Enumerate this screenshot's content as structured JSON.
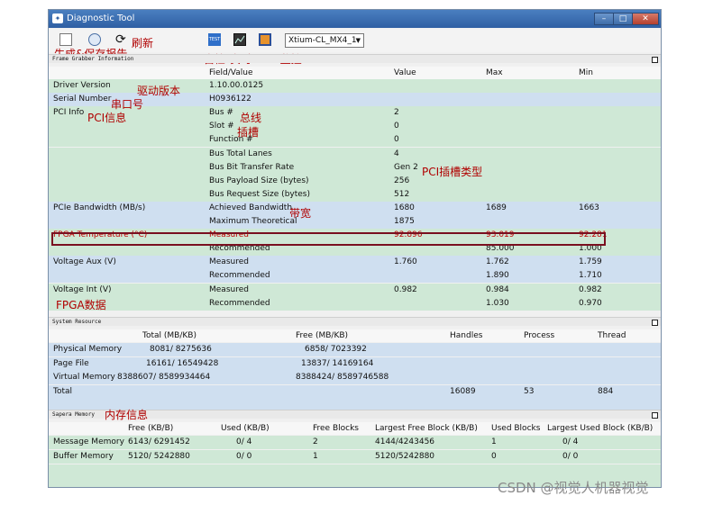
{
  "window": {
    "title": "Diagnostic Tool",
    "app_icon": "teledyne-icon",
    "min": "–",
    "max": "□",
    "close": "✕"
  },
  "toolbar": {
    "refresh": "⟳",
    "test": "TEST",
    "combo_value": "Xtium-CL_MX4_1"
  },
  "annotations": {
    "report": "生成&保存报告",
    "refresh": "刷新",
    "selftest": "自检",
    "fpga_monitor": "实时FPGA监控",
    "driver": "驱动版本",
    "serial": "串口号",
    "pci_info": "PCI信息",
    "bus": "总线",
    "slot": "插槽",
    "pci_slot_type": "PCI插槽类型",
    "bandwidth": "带宽",
    "fpga_data": "FPGA数据",
    "memory_info": "内存信息"
  },
  "frame_grabber": {
    "title": "Frame Grabber Information",
    "headers": {
      "field": "Field/Value",
      "value": "Value",
      "max": "Max",
      "min": "Min"
    },
    "rows": [
      {
        "name": "Driver Version",
        "field": "1.10.00.0125",
        "value": "",
        "max": "",
        "min": "",
        "color": "green"
      },
      {
        "name": "Serial Number",
        "field": "H0936122",
        "value": "",
        "max": "",
        "min": "",
        "color": "blue"
      },
      {
        "name": "PCI Info",
        "field": "Bus #",
        "value": "2",
        "max": "",
        "min": "",
        "color": "green"
      },
      {
        "name": "",
        "field": "Slot #",
        "value": "0",
        "max": "",
        "min": "",
        "color": "green"
      },
      {
        "name": "",
        "field": "Function #",
        "value": "0",
        "max": "",
        "min": "",
        "color": "green"
      },
      {
        "name": "",
        "field": "Bus Total Lanes",
        "value": "4",
        "max": "",
        "min": "",
        "color": "green"
      },
      {
        "name": "",
        "field": "Bus Bit Transfer Rate",
        "value": "Gen 2",
        "max": "",
        "min": "",
        "color": "green"
      },
      {
        "name": "",
        "field": "Bus Payload Size (bytes)",
        "value": "256",
        "max": "",
        "min": "",
        "color": "green"
      },
      {
        "name": "",
        "field": "Bus Request Size (bytes)",
        "value": "512",
        "max": "",
        "min": "",
        "color": "green"
      },
      {
        "name": "PCIe Bandwidth (MB/s)",
        "field": "Achieved Bandwidth",
        "value": "1680",
        "max": "1689",
        "min": "1663",
        "color": "blue"
      },
      {
        "name": "",
        "field": "Maximum Theoretical",
        "value": "1875",
        "max": "",
        "min": "",
        "color": "blue"
      },
      {
        "name": "FPGA Temperature (°C)",
        "field": "Measured",
        "value": "92.896",
        "max": "93.019",
        "min": "92.281",
        "color": "green"
      },
      {
        "name": "",
        "field": "Recommended",
        "value": "",
        "max": "85.000",
        "min": "1.000",
        "color": "green"
      },
      {
        "name": "Voltage Aux (V)",
        "field": "Measured",
        "value": "1.760",
        "max": "1.762",
        "min": "1.759",
        "color": "blue"
      },
      {
        "name": "",
        "field": "Recommended",
        "value": "",
        "max": "1.890",
        "min": "1.710",
        "color": "blue"
      },
      {
        "name": "Voltage Int (V)",
        "field": "Measured",
        "value": "0.982",
        "max": "0.984",
        "min": "0.982",
        "color": "green"
      },
      {
        "name": "",
        "field": "Recommended",
        "value": "",
        "max": "1.030",
        "min": "0.970",
        "color": "green"
      }
    ]
  },
  "system_resource": {
    "title": "System Resource",
    "headers": {
      "total": "Total (MB/KB)",
      "free": "Free  (MB/KB)",
      "handles": "Handles",
      "process": "Process",
      "thread": "Thread"
    },
    "rows": [
      {
        "name": "Physical Memory",
        "total": "8081/ 8275636",
        "free": "6858/ 7023392",
        "handles": "",
        "process": "",
        "thread": ""
      },
      {
        "name": "Page File",
        "total": "16161/ 16549428",
        "free": "13837/ 14169164",
        "handles": "",
        "process": "",
        "thread": ""
      },
      {
        "name": "Virtual Memory",
        "total": "8388607/ 8589934464",
        "free": "8388424/ 8589746588",
        "handles": "",
        "process": "",
        "thread": ""
      },
      {
        "name": "Total",
        "total": "",
        "free": "",
        "handles": "16089",
        "process": "53",
        "thread": "884"
      }
    ]
  },
  "sapera_memory": {
    "title": "Sapera Memory",
    "headers": {
      "free": "Free (KB/B)",
      "used": "Used (KB/B)",
      "free_blocks": "Free Blocks",
      "largest_free": "Largest Free Block (KB/B)",
      "used_blocks": "Used Blocks",
      "largest_used": "Largest Used Block (KB/B)"
    },
    "rows": [
      {
        "name": "Message Memory",
        "free": "6143/ 6291452",
        "used": "0/    4",
        "free_blocks": "2",
        "largest_free": "4144/4243456",
        "used_blocks": "1",
        "largest_used": "0/    4"
      },
      {
        "name": "Buffer Memory",
        "free": "5120/ 5242880",
        "used": "0/    0",
        "free_blocks": "1",
        "largest_free": "5120/5242880",
        "used_blocks": "0",
        "largest_used": "0/    0"
      }
    ]
  },
  "watermark": "CSDN @视觉人机器视觉"
}
